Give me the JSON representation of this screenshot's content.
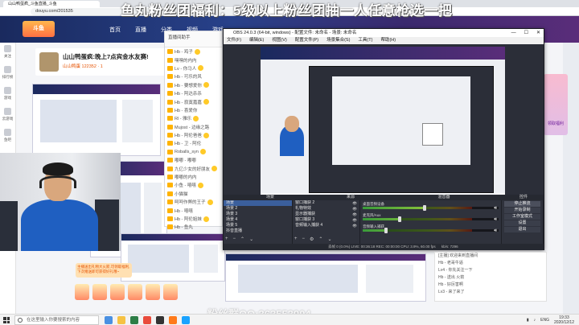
{
  "browser": {
    "tab_title": "山山鸭蛋疯_斗鱼直播_斗鱼",
    "address": "douyu.com/201535"
  },
  "site": {
    "logo": "斗鱼",
    "nav": [
      "首页",
      "直播",
      "分类",
      "视频",
      "游戏"
    ]
  },
  "left_rail": [
    "关注",
    "排行榜",
    "游戏",
    "云游戏",
    "鱼吧"
  ],
  "room": {
    "title": "山山鸭蛋疯:晚上7点宾金水友赛!",
    "subtitle": "山山鸭蛋 122352 · 1"
  },
  "promo": {
    "label": "领取福利"
  },
  "chat": {
    "header": "直播间助手",
    "lines": [
      "Hb - 鸡子",
      "嘿嘿的内内",
      "Lv - 你马人",
      "Hb - 可乐的风",
      "Hb - 要想爱你",
      "Hb - 阿达杀杀",
      "Hb - 寂寞嘉嘉",
      "Hb - 喜爱你",
      "Rl - 雅乐",
      "Mujost - 边缘之路",
      "Hb - 阿伦爸爸",
      "Hb - 卫 - 阿伦",
      "Roballs_syn",
      "嘟嘟 - 嘟嘟",
      "九亿少女的好朋友",
      "嘟嘟的内内",
      "小鱼 - 嘻嘻",
      "小猫猫",
      "呵呵作弊的王子",
      "Hb - 嘻嘻",
      "Hb - 阿伦姐妹",
      "Hb - 鱼丸"
    ]
  },
  "obs": {
    "title": "OBS 24.0.3 (64-bit, windows) - 配置文件: 未命名 - 场景: 未命名",
    "menu": [
      "文件(F)",
      "编辑(E)",
      "视图(V)",
      "配置文件(P)",
      "场景集合(S)",
      "工具(T)",
      "帮助(H)"
    ],
    "docks": [
      "场景",
      "来源",
      "混音器",
      "控件"
    ],
    "scenes": [
      "场景",
      "场景 2",
      "场景 3",
      "场景 4",
      "场景 5",
      "抖音直播"
    ],
    "sources": [
      "窗口捕获 2",
      "礼物特效",
      "显示器捕获",
      "窗口捕获 3",
      "音频输入捕获 4"
    ],
    "mixer": [
      {
        "name": "桌面音频设备",
        "level": 0.55,
        "db": "0.0 dB"
      },
      {
        "name": "麦克风/Aux",
        "level": 0.32,
        "db": "0.0 dB"
      },
      {
        "name": "音频输入捕获",
        "level": 0.2,
        "db": "0.0 dB"
      }
    ],
    "controls": [
      "停止推流",
      "开始录制",
      "工作室模式",
      "设置",
      "退出"
    ],
    "status": "丢帧 0 (0.0%)   LIVE: 00:36:18   REC: 00:00:00   CPU: 3.9%, 60.00 fps",
    "status_kb": "kb/s: 7296"
  },
  "bottom_chat": {
    "lines": [
      "[主播] 欢迎来到直播间",
      "Hb - 老哥牛逼",
      "Lv4 - 你先关注一下",
      "Hb - 送出 火箭",
      "Hb - 好厉害啊",
      "Lv3 - 来了来了"
    ]
  },
  "gift_banner": "主播送出礼物大火箭,可领取福利,下次赠送即可获得好礼哦~",
  "overlays": {
    "banner": "鱼丸粉丝团福利：5级以上粉丝团抽一人任意枪选一把",
    "qq": "粉丝群QQ:363553904"
  },
  "taskbar": {
    "search_placeholder": "在这里输入你要搜索的内容",
    "lang": "ENG",
    "time": "19:33",
    "date": "2020/12/12"
  },
  "colors": {
    "obs_bg": "#2b2e38",
    "site_header": "#28418a",
    "shirt_blue": "#1f5fc1"
  }
}
